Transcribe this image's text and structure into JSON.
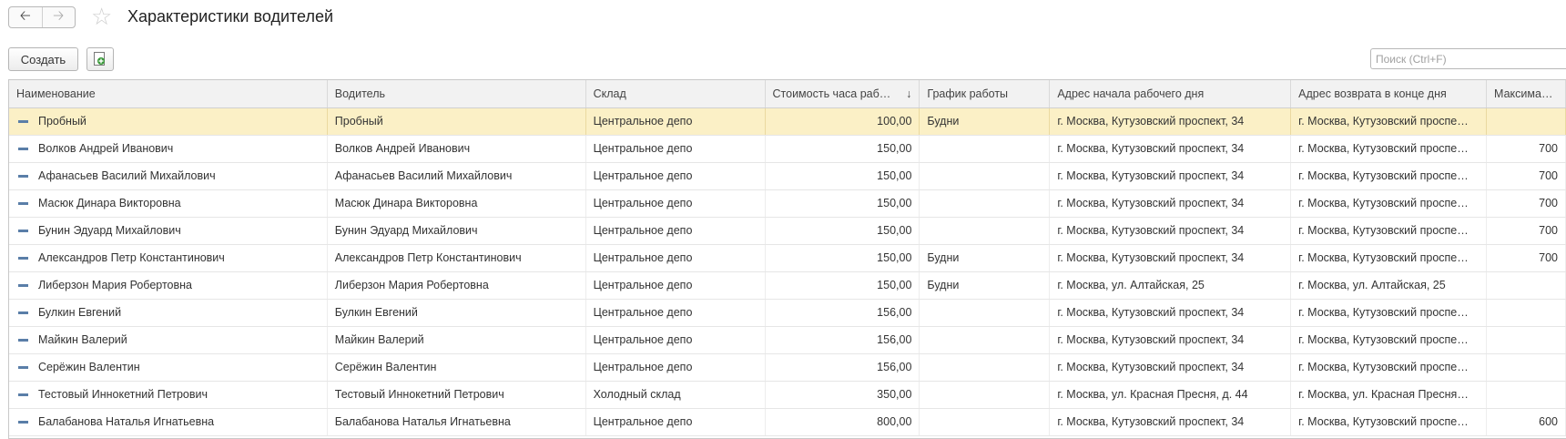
{
  "header": {
    "title": "Характеристики водителей"
  },
  "icons": {
    "back": "arrow-left-icon",
    "forward": "arrow-right-icon",
    "favorite": "star-icon",
    "copy": "copy-add-icon"
  },
  "toolbar": {
    "create_label": "Создать"
  },
  "search": {
    "placeholder": "Поиск (Ctrl+F)",
    "value": ""
  },
  "table": {
    "columns": [
      "Наименование",
      "Водитель",
      "Склад",
      "Стоимость часа раб…",
      "График работы",
      "Адрес начала рабочего дня",
      "Адрес возврата в конце дня",
      "Максима…"
    ],
    "sort_indicator": "↓",
    "rows": [
      {
        "name": "Пробный",
        "driver": "Пробный",
        "warehouse": "Центральное депо",
        "cost": "100,00",
        "schedule": "Будни",
        "start": "г. Москва, Кутузовский проспект, 34",
        "return": "г. Москва, Кутузовский проспе…",
        "max": ""
      },
      {
        "name": "Волков Андрей Иванович",
        "driver": "Волков Андрей Иванович",
        "warehouse": "Центральное депо",
        "cost": "150,00",
        "schedule": "",
        "start": "г. Москва, Кутузовский проспект, 34",
        "return": "г. Москва, Кутузовский проспе…",
        "max": "700"
      },
      {
        "name": "Афанасьев Василий Михайлович",
        "driver": "Афанасьев Василий Михайлович",
        "warehouse": "Центральное депо",
        "cost": "150,00",
        "schedule": "",
        "start": "г. Москва, Кутузовский проспект, 34",
        "return": "г. Москва, Кутузовский проспе…",
        "max": "700"
      },
      {
        "name": "Масюк Динара Викторовна",
        "driver": "Масюк Динара Викторовна",
        "warehouse": "Центральное депо",
        "cost": "150,00",
        "schedule": "",
        "start": "г. Москва, Кутузовский проспект, 34",
        "return": "г. Москва, Кутузовский проспе…",
        "max": "700"
      },
      {
        "name": "Бунин Эдуард Михайлович",
        "driver": "Бунин Эдуард Михайлович",
        "warehouse": "Центральное депо",
        "cost": "150,00",
        "schedule": "",
        "start": "г. Москва, Кутузовский проспект, 34",
        "return": "г. Москва, Кутузовский проспе…",
        "max": "700"
      },
      {
        "name": "Александров Петр Константинович",
        "driver": "Александров Петр Константинович",
        "warehouse": "Центральное депо",
        "cost": "150,00",
        "schedule": "Будни",
        "start": "г. Москва, Кутузовский проспект, 34",
        "return": "г. Москва, Кутузовский проспе…",
        "max": "700"
      },
      {
        "name": "Либерзон Мария Робертовна",
        "driver": "Либерзон Мария Робертовна",
        "warehouse": "Центральное депо",
        "cost": "150,00",
        "schedule": "Будни",
        "start": "г. Москва, ул. Алтайская, 25",
        "return": "г. Москва, ул. Алтайская, 25",
        "max": ""
      },
      {
        "name": "Булкин Евгений",
        "driver": "Булкин Евгений",
        "warehouse": "Центральное депо",
        "cost": "156,00",
        "schedule": "",
        "start": "г. Москва, Кутузовский проспект, 34",
        "return": "г. Москва, Кутузовский проспе…",
        "max": ""
      },
      {
        "name": "Майкин Валерий",
        "driver": "Майкин Валерий",
        "warehouse": "Центральное депо",
        "cost": "156,00",
        "schedule": "",
        "start": "г. Москва, Кутузовский проспект, 34",
        "return": "г. Москва, Кутузовский проспе…",
        "max": ""
      },
      {
        "name": "Серёжин Валентин",
        "driver": "Серёжин Валентин",
        "warehouse": "Центральное депо",
        "cost": "156,00",
        "schedule": "",
        "start": "г. Москва, Кутузовский проспект, 34",
        "return": "г. Москва, Кутузовский проспе…",
        "max": ""
      },
      {
        "name": "Тестовый Иннокетний Петрович",
        "driver": "Тестовый Иннокетний Петрович",
        "warehouse": "Холодный склад",
        "cost": "350,00",
        "schedule": "",
        "start": "г. Москва, ул. Красная Пресня, д. 44",
        "return": "г. Москва, ул. Красная Пресня…",
        "max": ""
      },
      {
        "name": "Балабанова Наталья Игнатьевна",
        "driver": "Балабанова Наталья Игнатьевна",
        "warehouse": "Центральное депо",
        "cost": "800,00",
        "schedule": "",
        "start": "г. Москва, Кутузовский проспект, 34",
        "return": "г. Москва, Кутузовский проспе…",
        "max": "600"
      }
    ]
  }
}
